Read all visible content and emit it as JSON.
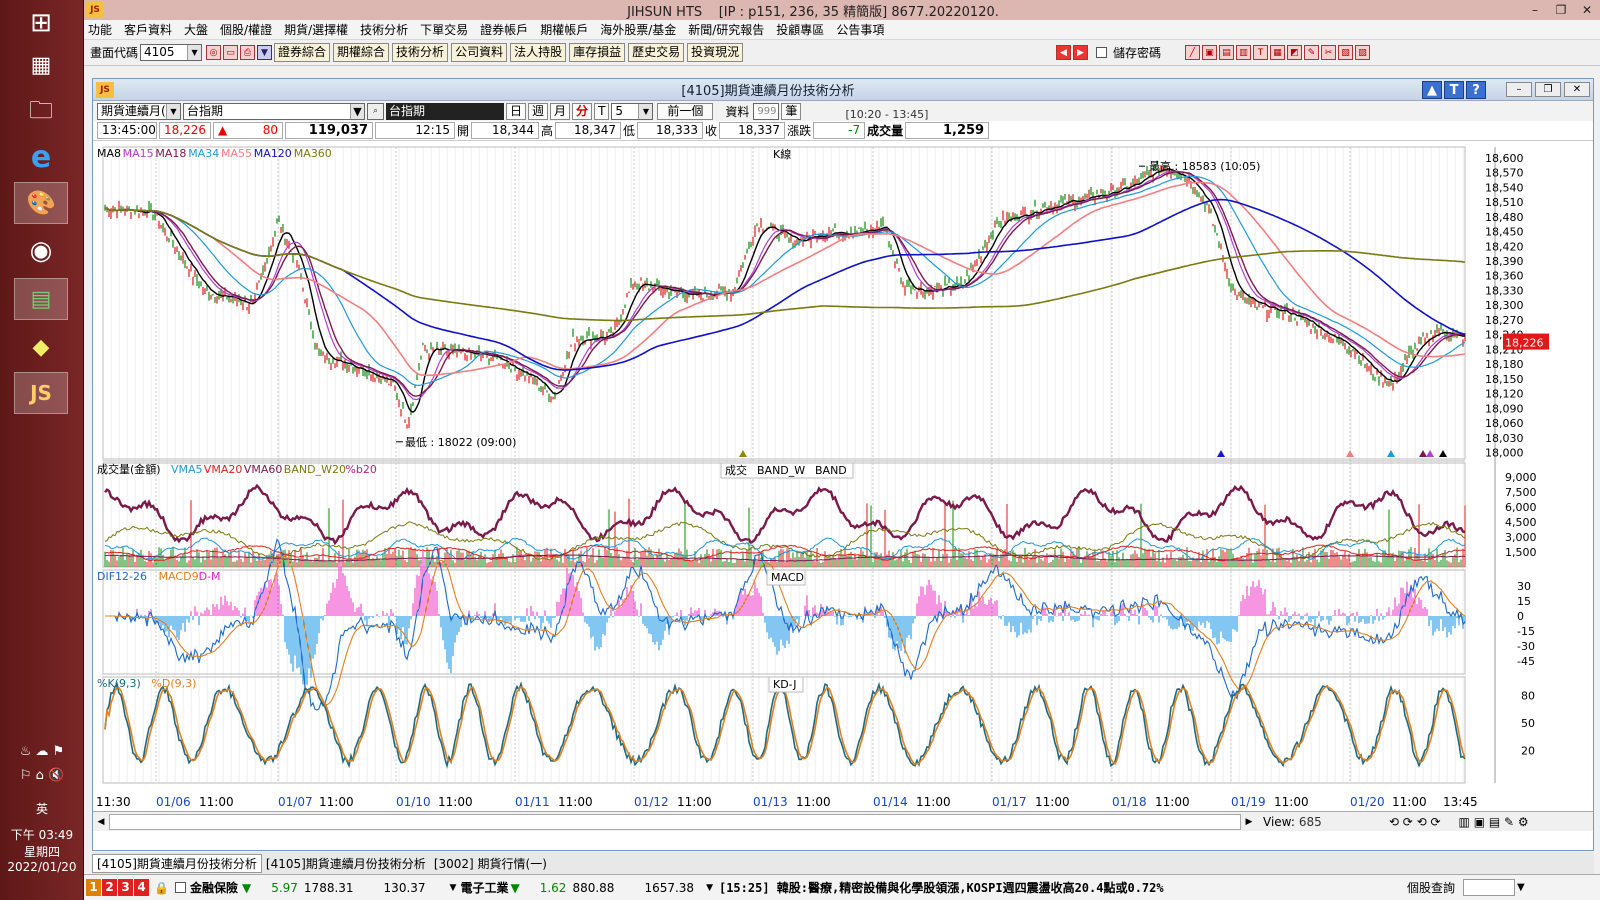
{
  "taskbar": {
    "tray_lang": "英",
    "time": "下午 03:49",
    "weekday": "星期四",
    "date": "2022/01/20"
  },
  "window": {
    "app_name": "JIHSUN HTS",
    "session": "[IP : p151, 236, 35 精簡版] 8677.20220120."
  },
  "menu": [
    "功能",
    "客戶資料",
    "大盤",
    "個股/權證",
    "期貨/選擇權",
    "技術分析",
    "下單交易",
    "證券帳戶",
    "期權帳戶",
    "海外股票/基金",
    "新聞/研究報告",
    "投顧專區",
    "公告事項"
  ],
  "toolbar": {
    "code_label": "畫面代碼",
    "code_value": "4105",
    "buttons": [
      "證券綜合",
      "期權綜合",
      "技術分析",
      "公司資料",
      "法人持股",
      "庫存損益",
      "歷史交易",
      "投資現況"
    ],
    "save_pwd": "儲存密碼"
  },
  "chartwin": {
    "title": "[4105]期貨連續月份技術分析",
    "product_type": "期貨連續月(",
    "product_name": "台指期",
    "product_display": "台指期",
    "periods": [
      "日",
      "週",
      "月",
      "分",
      "T"
    ],
    "active_period": "分",
    "minutes": "5",
    "prev_btn": "前一個",
    "data_label": "資料",
    "data_count": "999",
    "unit": "筆",
    "time_range": "[10:20 - 13:45]"
  },
  "quote": {
    "time": "13:45:00",
    "price": "18,226",
    "change": "80",
    "volume": "119,037",
    "bar_time": "12:15",
    "open_label": "開",
    "open": "18,344",
    "high_label": "高",
    "high": "18,347",
    "low_label": "低",
    "low": "18,333",
    "close_label": "收",
    "close": "18,337",
    "chg_label": "漲跌",
    "chg": "-7",
    "vol_label": "成交量",
    "vol": "1,259"
  },
  "kline": {
    "panel_label": "K線",
    "legend": [
      {
        "name": "MA8",
        "color": "#000000"
      },
      {
        "name": "MA15",
        "color": "#b040d0"
      },
      {
        "name": "MA18",
        "color": "#7a1a4a"
      },
      {
        "name": "MA34",
        "color": "#1e9ad8"
      },
      {
        "name": "MA55",
        "color": "#f08080"
      },
      {
        "name": "MA120",
        "color": "#1010c8"
      },
      {
        "name": "MA360",
        "color": "#7a7a10"
      }
    ],
    "max_label": "最高 : 18583 (10:05)",
    "min_label": "最低 : 18022 (09:00)",
    "last_price": "18,226",
    "y_ticks": [
      "18,600",
      "18,570",
      "18,540",
      "18,510",
      "18,480",
      "18,450",
      "18,420",
      "18,390",
      "18,360",
      "18,330",
      "18,300",
      "18,270",
      "18,240",
      "18,210",
      "18,180",
      "18,150",
      "18,120",
      "18,090",
      "18,060",
      "18,030",
      "18,000"
    ]
  },
  "volume": {
    "panel_label": "成交",
    "panel_label2": "BAND_W",
    "panel_label3": "BAND",
    "legend": [
      {
        "name": "成交量(金額)",
        "color": "#000000"
      },
      {
        "name": "VMA5",
        "color": "#1e9ad8"
      },
      {
        "name": "VMA20",
        "color": "#e02020"
      },
      {
        "name": "VMA60",
        "color": "#7a1a4a"
      },
      {
        "name": "BAND_W20",
        "color": "#7a7a10"
      },
      {
        "name": "%b20",
        "color": "#c02080"
      }
    ],
    "y_ticks": [
      "9,000",
      "7,500",
      "6,000",
      "4,500",
      "3,000",
      "1,500"
    ]
  },
  "macd": {
    "panel_label": "MACD",
    "legend": [
      {
        "name": "DIF12-26",
        "color": "#1e6ac8"
      },
      {
        "name": "MACD9",
        "color": "#e08020"
      },
      {
        "name": "D-M",
        "color": "#e020c0"
      }
    ],
    "y_ticks": [
      "30",
      "15",
      "0",
      "-15",
      "-30",
      "-45"
    ]
  },
  "kd": {
    "panel_label": "KD-J",
    "legend": [
      {
        "name": "%K(9,3)",
        "color": "#1e6a80"
      },
      {
        "name": "%D(9,3)",
        "color": "#e08020"
      }
    ],
    "y_ticks": [
      "80",
      "50",
      "20"
    ]
  },
  "xaxis": [
    "11:30",
    "01/06",
    "11:00",
    "01/07",
    "11:00",
    "01/10",
    "11:00",
    "01/11",
    "11:00",
    "01/12",
    "11:00",
    "01/13",
    "11:00",
    "01/14",
    "11:00",
    "01/17",
    "11:00",
    "01/18",
    "11:00",
    "01/19",
    "11:00",
    "01/20",
    "11:00",
    "13:45"
  ],
  "view": {
    "label": "View:",
    "value": "685"
  },
  "tabs": [
    "[4105]期貨連續月份技術分析",
    "[4105]期貨連續月份技術分析",
    "[3002] 期貨行情(一)"
  ],
  "status": {
    "sector1": "金融保險",
    "s1_chg": "5.97",
    "s1_idx": "1788.31",
    "s1_vol": "130.37",
    "sector2": "電子工業",
    "s2_chg": "1.62",
    "s2_idx": "880.88",
    "s2_vol": "1657.38",
    "news": "[15:25] 韓股:醫療,精密設備與化學股領漲,KOSPI週四震盪收高20.4點或0.72%",
    "right_label": "個股查詢"
  }
}
